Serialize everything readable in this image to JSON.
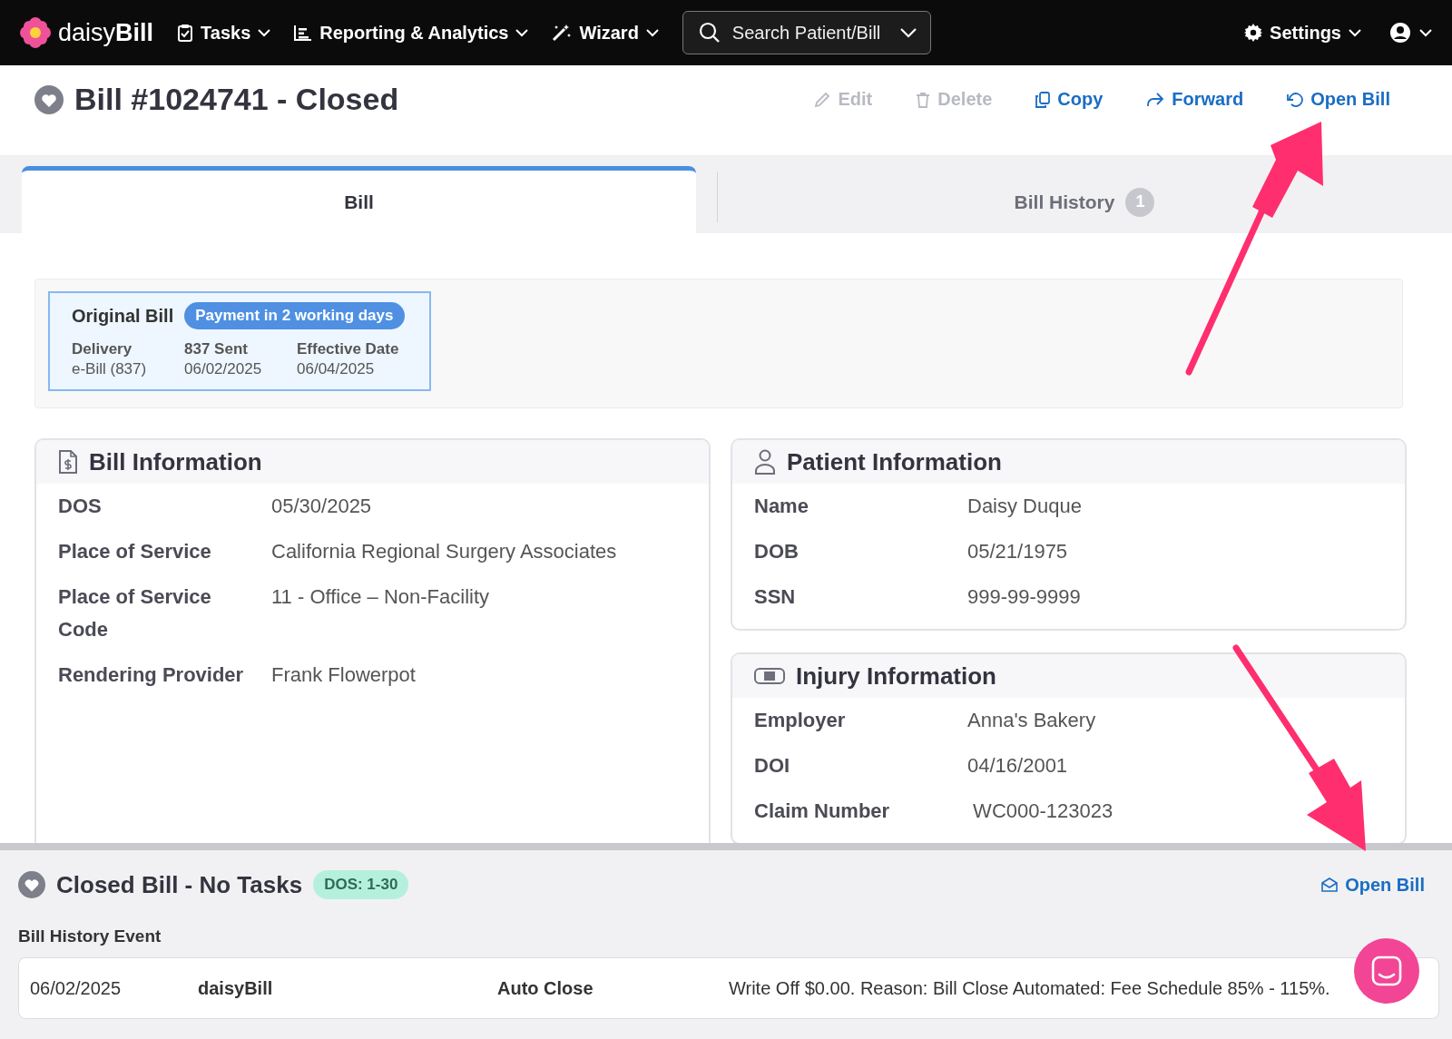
{
  "nav": {
    "logo": "daisy**Bill**",
    "menus": [
      {
        "label": "Tasks",
        "kind": "tasks"
      },
      {
        "label": "Reporting & Analytics",
        "kind": "chart"
      },
      {
        "label": "Wizard",
        "kind": "wand"
      }
    ],
    "search": {
      "placeholder": "Search Patient/Bill"
    },
    "settings": "Settings"
  },
  "header": {
    "title": "Bill #1024741 - Closed",
    "actions": [
      {
        "label": "Edit",
        "kind": "edit",
        "disabled": true
      },
      {
        "label": "Delete",
        "kind": "delete",
        "disabled": true
      },
      {
        "label": "Copy",
        "kind": "copy",
        "disabled": false
      },
      {
        "label": "Forward",
        "kind": "forward",
        "disabled": false
      },
      {
        "label": "Open Bill",
        "kind": "reopen",
        "disabled": false
      }
    ]
  },
  "tabs": [
    {
      "label": "Bill",
      "selected": true
    },
    {
      "label": "Bill History",
      "selected": false,
      "badge": "1"
    }
  ],
  "original_bill": {
    "title": "Original Bill",
    "badge": "Payment in 2 working days",
    "fields": [
      {
        "label": "Delivery",
        "value": "e-Bill (837)"
      },
      {
        "label": "837 Sent",
        "value": "06/02/2025"
      },
      {
        "label": "Effective Date",
        "value": "06/04/2025"
      }
    ]
  },
  "cards": [
    {
      "title": "Bill Information",
      "kind": "bill",
      "rows": [
        {
          "label": "DOS",
          "value": "05/30/2025"
        },
        {
          "label": "Place of Service",
          "value": "California Regional Surgery Associates"
        },
        {
          "label": "Place of Service Code",
          "value": "11 - Office – Non-Facility"
        },
        {
          "label": "Rendering Provider",
          "value": "Frank Flowerpot"
        }
      ]
    },
    {
      "title": "Patient Information",
      "kind": "patient",
      "rows": [
        {
          "label": "Name",
          "value": "Daisy Duque"
        },
        {
          "label": "DOB",
          "value": "05/21/1975"
        },
        {
          "label": "SSN",
          "value": "999-99-9999"
        }
      ]
    },
    {
      "title": "Injury Information",
      "kind": "injury",
      "rows": [
        {
          "label": "Employer",
          "value": "Anna's Bakery"
        },
        {
          "label": "DOI",
          "value": "04/16/2001"
        },
        {
          "label": "Claim Number",
          "value": " WC000-123023"
        }
      ]
    }
  ],
  "bottom_panel": {
    "title": "Closed Bill - No Tasks",
    "tag": "DOS: 1-30",
    "action": "Open Bill",
    "section_title": "Bill History Event",
    "events": [
      {
        "date": "06/02/2025",
        "user": "daisyBill",
        "action": "Auto Close",
        "description": "Write Off $0.00. Reason: Bill Close Automated: Fee Schedule 85% - 115%."
      }
    ]
  }
}
